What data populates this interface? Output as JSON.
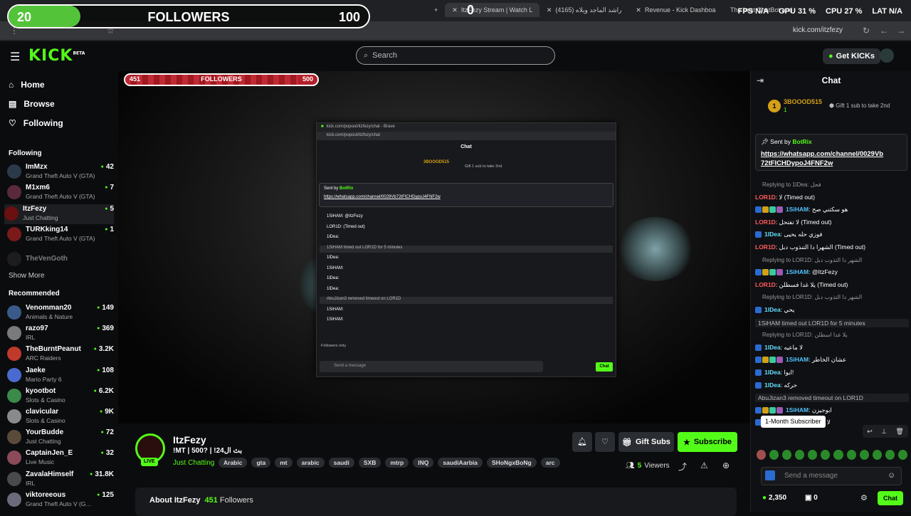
{
  "browser": {
    "tabs": [
      {
        "label": "ItzFezy Stream | Watch Live on Kick",
        "active": true
      },
      {
        "label": "(4165) راشد الماجد ويلاه",
        "active": false
      },
      {
        "label": "Revenue - Kick Dashboard",
        "active": false
      },
      {
        "label": "The best ChatBot and Widget",
        "active": false
      }
    ],
    "url": "kick.com/itzfezy"
  },
  "overlays": {
    "followers_goal": {
      "start": "20",
      "title": "FOLLOWERS",
      "end": "100",
      "progress": 0.2
    },
    "kick_counter": "0",
    "stats": [
      {
        "label": "FPS",
        "value": "N/A"
      },
      {
        "label": "GPU",
        "value": "31 %"
      },
      {
        "label": "CPU",
        "value": "27 %"
      },
      {
        "label": "LAT",
        "value": "N/A"
      }
    ],
    "video_goal": {
      "start": "451",
      "title": "FOLLOWERS",
      "end": "500",
      "progress": 0.9
    }
  },
  "header": {
    "logo": "KICK",
    "logo_badge": "BETA",
    "search_placeholder": "Search",
    "get_kicks": "Get KICKs"
  },
  "sidebar": {
    "nav": [
      {
        "label": "Home",
        "icon": "home-icon"
      },
      {
        "label": "Browse",
        "icon": "browse-icon"
      },
      {
        "label": "Following",
        "icon": "heart-icon"
      }
    ],
    "following_heading": "Following",
    "following": [
      {
        "name": "ImMzx",
        "category": "Grand Theft Auto V (GTA)",
        "viewers": "42",
        "color": "#2b3a4a"
      },
      {
        "name": "M1xm6",
        "category": "Grand Theft Auto V (GTA)",
        "viewers": "7",
        "color": "#5a2a3a"
      },
      {
        "name": "ItzFezy",
        "category": "Just Chatting",
        "viewers": "5",
        "color": "#6a1010"
      },
      {
        "name": "TURKking14",
        "category": "Grand Theft Auto V (GTA)",
        "viewers": "1",
        "color": "#7a1a1a"
      }
    ],
    "offline": [
      {
        "name": "TheVenGoth"
      }
    ],
    "show_more": "Show More",
    "recommended_heading": "Recommended",
    "recommended": [
      {
        "name": "Venomman20",
        "category": "Animals & Nature",
        "viewers": "149",
        "color": "#3a5a8a"
      },
      {
        "name": "razo97",
        "category": "IRL",
        "viewers": "369",
        "color": "#7a7a7a"
      },
      {
        "name": "TheBurntPeanut",
        "category": "ARC Raiders",
        "viewers": "3.2K",
        "color": "#c0392b"
      },
      {
        "name": "Jaeke",
        "category": "Mario Party 6",
        "viewers": "108",
        "color": "#4a6ad1"
      },
      {
        "name": "kyootbot",
        "category": "Slots & Casino",
        "viewers": "6.2K",
        "color": "#3a8a4a"
      },
      {
        "name": "clavicular",
        "category": "Slots & Casino",
        "viewers": "9K",
        "color": "#8a8a8a"
      },
      {
        "name": "YourBudde",
        "category": "Just Chatting",
        "viewers": "72",
        "color": "#5a4a3a"
      },
      {
        "name": "CaptainJen_E",
        "category": "Live Music",
        "viewers": "32",
        "color": "#8a4a5a"
      },
      {
        "name": "ZavalaHimself",
        "category": "IRL",
        "viewers": "31.8K",
        "color": "#4a4a4a"
      },
      {
        "name": "viktoreeous",
        "category": "Grand Theft Auto V (G...",
        "viewers": "125",
        "color": "#6a6a7a"
      }
    ]
  },
  "popout": {
    "window_title": "kick.com/popout/itzfezy/chat - Brave",
    "url": "kick.com/popout/itzfezy/chat",
    "chat_title": "Chat",
    "gifter": "3BOOOD515",
    "gift_cta": "Gift 1 sub to take 2nd",
    "sent_by": "Sent by",
    "bot": "BotRix",
    "link": "https://whatsapp.com/channel/0029Vb72tFICHDypoJ4FNF2w",
    "lines": [
      "1SiHAM: @ItzFezy",
      "LOR1D: (Timed out)",
      "1lDea:",
      "1SiHAM timed out LOR1D for 5 minutes",
      "1lDea:",
      "1SiHAM:",
      "1lDea:",
      "1lDea:",
      "AbuJizan3 removed timeout on LOR1D",
      "1SiHAM:",
      "1SiHAM:"
    ],
    "followers_only": "Followers only",
    "input_placeholder": "Send a message",
    "send": "Chat"
  },
  "stream": {
    "channel": "ItzFezy",
    "live": "LIVE",
    "title": "!MT | 500? | !بث ال24",
    "category": "Just Chatting",
    "tags": [
      "Arabic",
      "gta",
      "mt",
      "arabic",
      "saudi",
      "SXB",
      "mtrp",
      "INQ",
      "saudiAarbia",
      "SHoNgxBoNg",
      "arc"
    ],
    "gift_subs": "Gift Subs",
    "subscribe": "Subscribe",
    "viewers_count": "5",
    "viewers_label": "Viewers",
    "about_name": "About ItzFezy",
    "followers_count": "451",
    "followers_label": "Followers"
  },
  "chat": {
    "title": "Chat",
    "top_gifter": {
      "name": "3BOOOD515",
      "count": "1",
      "rank": "1",
      "cta": "Gift 1 sub to take 2nd"
    },
    "pinned": {
      "sent_by": "Sent by",
      "bot": "BotRix",
      "link_line1": "https://whatsapp.com/channel/0029Vb",
      "link_line2": "72tFICHDypoJ4FNF2w"
    },
    "messages": [
      {
        "type": "reply",
        "text": "Replying to 1lDea: فحل"
      },
      {
        "type": "msg",
        "user": "LOR1D",
        "color": "red",
        "text": "لا (Timed out)",
        "badges": 0
      },
      {
        "type": "msg",
        "user": "1SiHAM",
        "color": "blue",
        "text": "هو سكتني صح",
        "badges": 4
      },
      {
        "type": "msg",
        "user": "LOR1D",
        "color": "red",
        "text": "لا تفتحل (Timed out)",
        "badges": 0
      },
      {
        "type": "msg",
        "user": "1lDea",
        "color": "cyan",
        "text": "فوزي حله يحيى",
        "badges": 1
      },
      {
        "type": "msg",
        "user": "LOR1D",
        "color": "red",
        "text": "الشهرا دا التنذوب دبل (Timed out)",
        "badges": 0
      },
      {
        "type": "reply",
        "text": "Replying to LOR1D: الشهر دا التذوب دبل"
      },
      {
        "type": "msg",
        "user": "1SiHAM",
        "color": "blue",
        "text": "@ItzFezy",
        "badges": 4
      },
      {
        "type": "msg",
        "user": "LOR1D",
        "color": "red",
        "text": "يلا غدا فسطلن (Timed out)",
        "badges": 0
      },
      {
        "type": "reply",
        "text": "Replying to LOR1D: الشهر دا التذوب دبل"
      },
      {
        "type": "msg",
        "user": "1lDea",
        "color": "cyan",
        "text": "يحي",
        "badges": 1
      },
      {
        "type": "sys",
        "text": "1SiHAM timed out LOR1D for 5 minutes"
      },
      {
        "type": "reply",
        "text": "Replying to LOR1D: يلا غدا اسطلن"
      },
      {
        "type": "msg",
        "user": "1lDea",
        "color": "cyan",
        "text": "لا ماعيه",
        "badges": 1
      },
      {
        "type": "msg",
        "user": "1SiHAM",
        "color": "blue",
        "text": "عشان الخاطر",
        "badges": 4
      },
      {
        "type": "msg",
        "user": "1lDea",
        "color": "cyan",
        "text": "ايوا!",
        "badges": 1
      },
      {
        "type": "msg",
        "user": "1lDea",
        "color": "cyan",
        "text": "حركه",
        "badges": 1
      },
      {
        "type": "sys",
        "text": "AbuJizan3 removed timeout on LOR1D"
      },
      {
        "type": "msg",
        "user": "1SiHAM",
        "color": "blue",
        "text": "ابوجيزن",
        "badges": 4
      },
      {
        "type": "msg",
        "user": "1SiHAM",
        "color": "blue",
        "text": "لا تدخل",
        "badges": 4
      }
    ],
    "tooltip": "1-Month Subscriber",
    "input_placeholder": "Send a message",
    "kicks": "2,350",
    "stickers": "0",
    "send": "Chat"
  },
  "colors": {
    "accent": "#53fc18",
    "bg": "#0b0c0e",
    "panel": "#18191c"
  }
}
